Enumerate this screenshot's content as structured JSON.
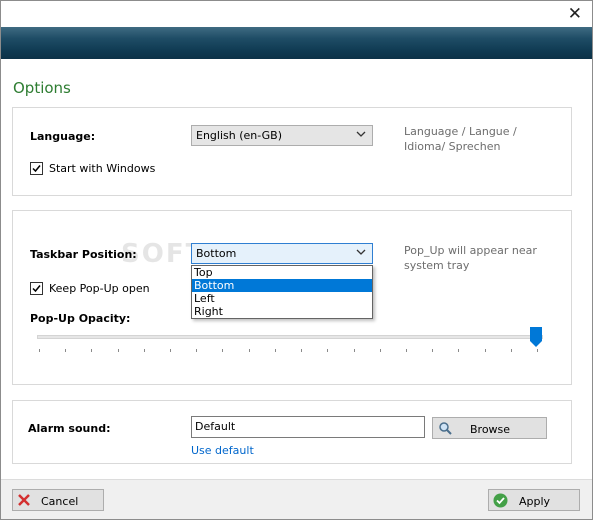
{
  "window": {
    "close_glyph": "✕",
    "heading": "Options"
  },
  "language": {
    "label": "Language:",
    "selected": "English (en-GB)",
    "hint": "Language / Langue / Idioma/ Sprechen",
    "start_with_windows_label": "Start with Windows",
    "start_with_windows_checked": true
  },
  "taskbar": {
    "label": "Taskbar Position:",
    "selected": "Bottom",
    "options": [
      "Top",
      "Bottom",
      "Left",
      "Right"
    ],
    "highlighted_option": "Bottom",
    "hint": "Pop_Up will appear near system tray",
    "keep_popup_label": "Keep Pop-Up open",
    "keep_popup_checked": true,
    "opacity_label": "Pop-Up Opacity:",
    "opacity_level": 1.0
  },
  "alarm": {
    "label": "Alarm sound:",
    "value": "Default",
    "browse_label": "Browse",
    "use_default_label": "Use default"
  },
  "footer": {
    "cancel_label": "Cancel",
    "apply_label": "Apply"
  },
  "watermark": "SOFTPEDIA",
  "colors": {
    "heading_green": "#2e7d32",
    "banner_blue": "#0f3a52",
    "selection_blue": "#0078d7",
    "link_blue": "#0066cc",
    "cancel_red": "#d32f2f",
    "apply_green": "#43a047"
  },
  "icons": {
    "close": "close-icon",
    "check": "checkmark-icon",
    "chevron": "chevron-down-icon",
    "search": "magnifier-icon",
    "cancel": "red-x-icon",
    "apply": "green-check-icon"
  }
}
